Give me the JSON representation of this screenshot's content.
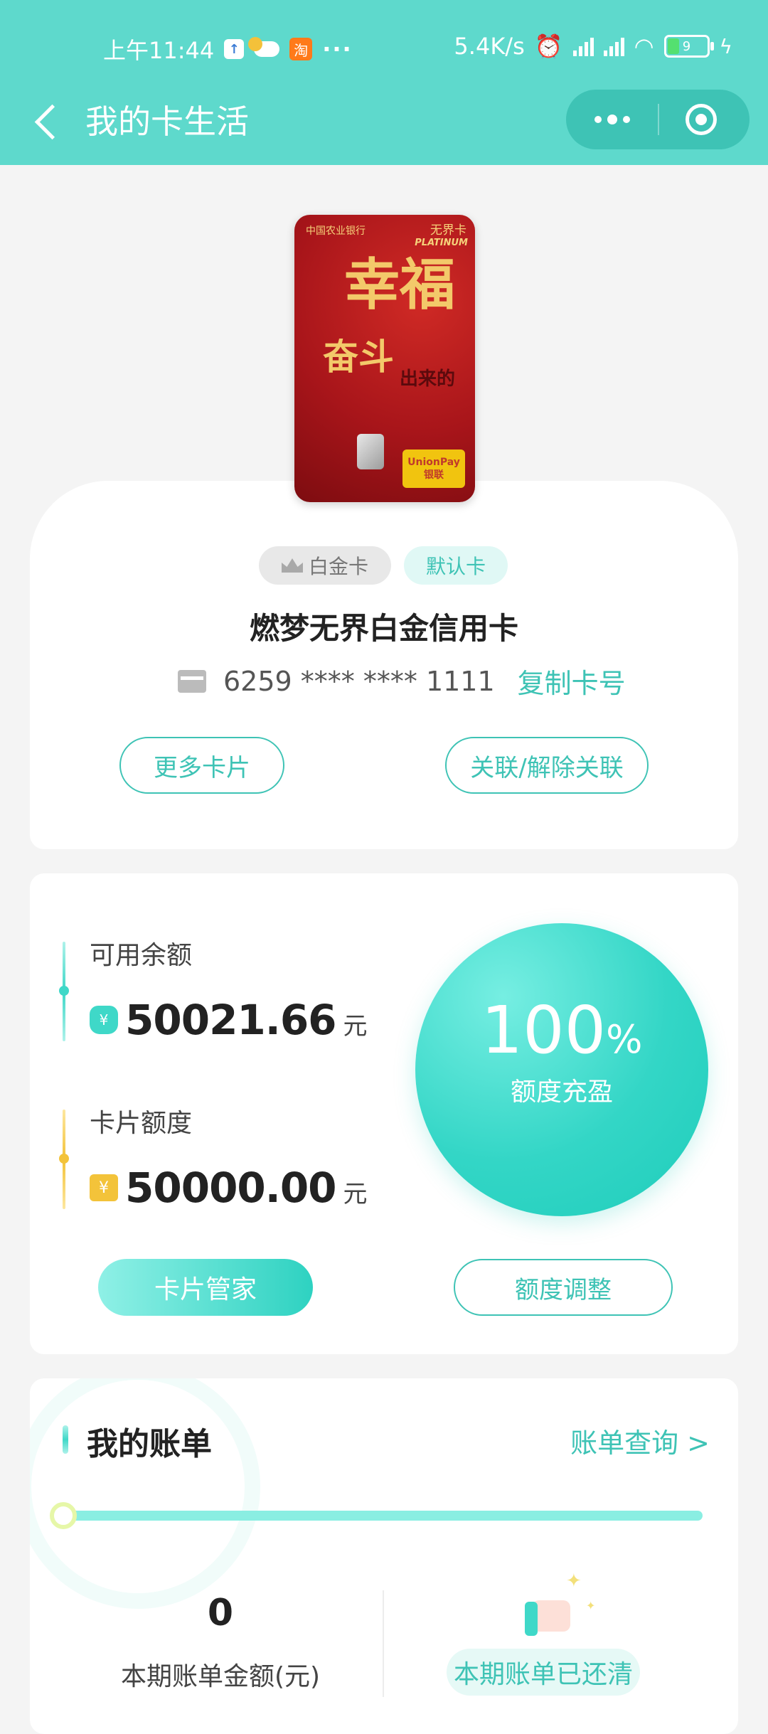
{
  "status_bar": {
    "time": "上午11:44",
    "dots": "···",
    "net_speed": "5.4K/s",
    "battery": "9"
  },
  "nav": {
    "title": "我的卡生活"
  },
  "card": {
    "bank_name": "中国农业银行",
    "brand": "无界卡",
    "brand_sub": "PLATINUM",
    "calligraphy_main": "幸福",
    "calligraphy_secondary": "奋斗",
    "calligraphy_small": "出来的",
    "unionpay_top": "UnionPay",
    "unionpay_bottom": "银联",
    "level_badge": "白金卡",
    "default_badge": "默认卡",
    "name": "燃梦无界白金信用卡",
    "number": "6259 **** **** 1111",
    "copy_label": "复制卡号",
    "more_cards_label": "更多卡片",
    "link_label": "关联/解除关联"
  },
  "credit": {
    "available_label": "可用余额",
    "available_amount": "50021.66",
    "limit_label": "卡片额度",
    "limit_amount": "50000.00",
    "unit": "元",
    "percent": "100",
    "percent_sign": "%",
    "status": "额度充盈",
    "manager_label": "卡片管家",
    "adjust_label": "额度调整"
  },
  "bill": {
    "title": "我的账单",
    "query_label": "账单查询 >",
    "amount_value": "0",
    "amount_label": "本期账单金额(元)",
    "status_label": "本期账单已还清"
  },
  "colors": {
    "accent": "#5ed9cc",
    "accent_dark": "#3ec3b5",
    "gold": "#f3c33a"
  }
}
